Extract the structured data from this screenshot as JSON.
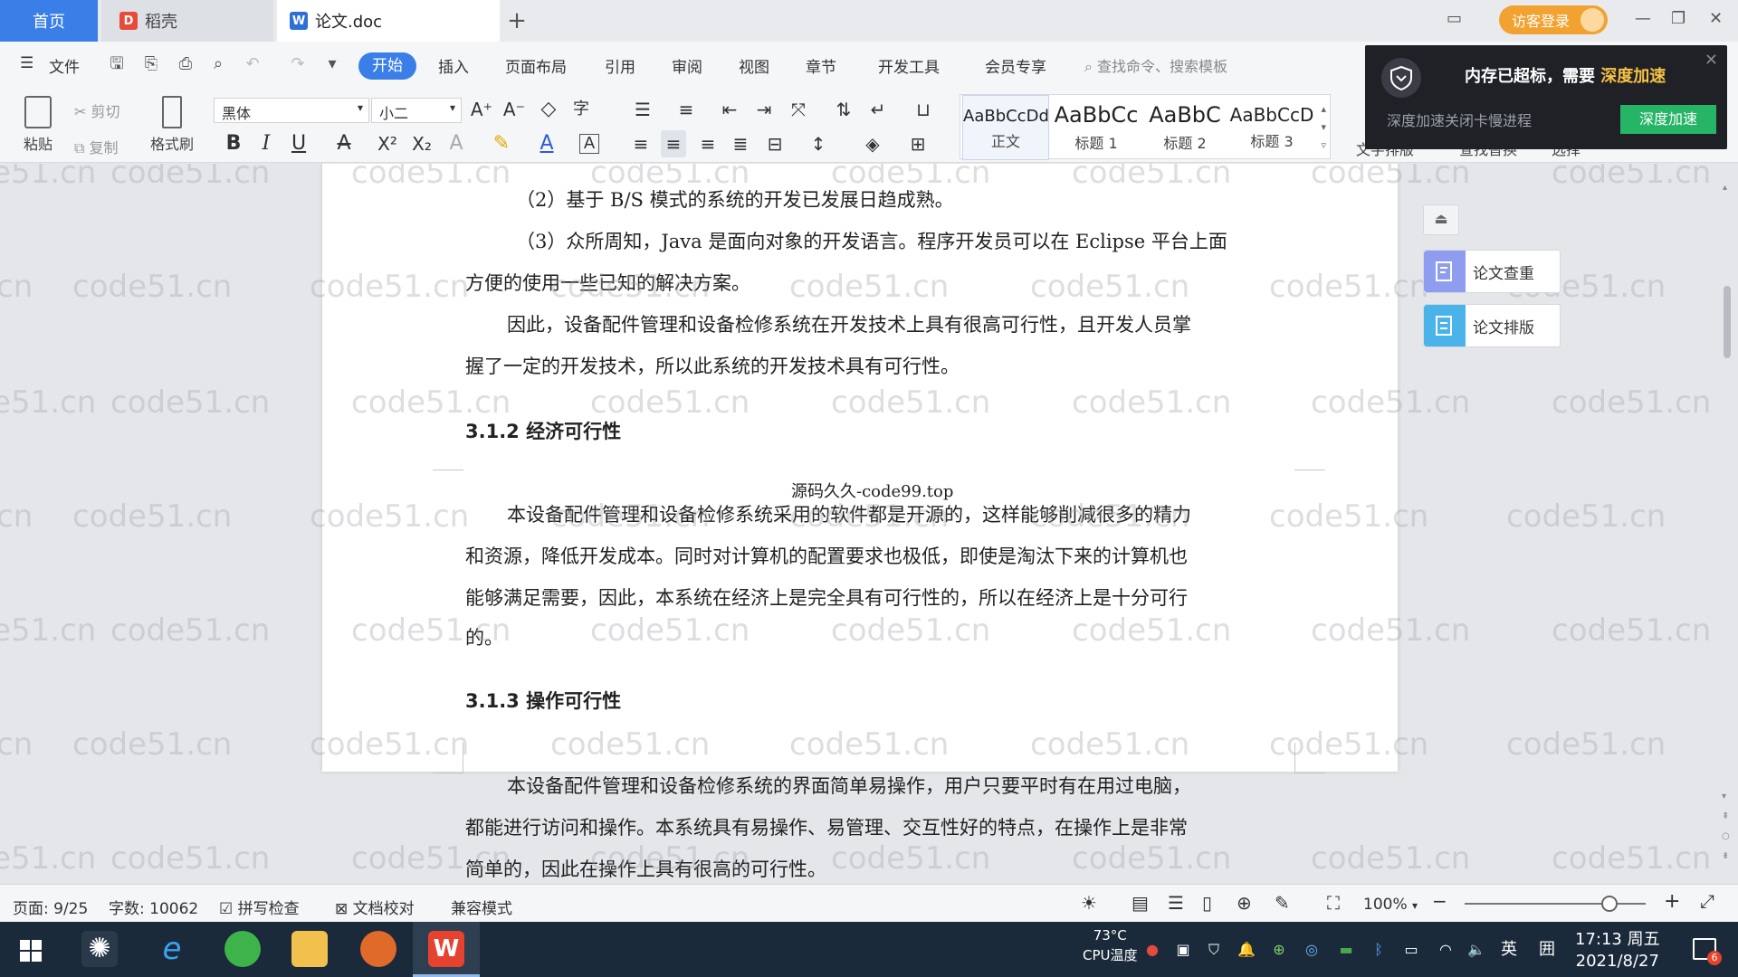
{
  "tabs": {
    "home": "首页",
    "daoke": "稻壳",
    "doc": "论文.doc",
    "new_tab": "+"
  },
  "visitor_login": "访客登录",
  "menu": {
    "file": "文件",
    "items": [
      "开始",
      "插入",
      "页面布局",
      "引用",
      "审阅",
      "视图",
      "章节",
      "开发工具",
      "会员专享"
    ],
    "search_placeholder": "查找命令、搜索模板"
  },
  "ribbon": {
    "paste": "粘贴",
    "cut": "剪切",
    "copy": "复制",
    "format_painter": "格式刷",
    "font": "黑体",
    "size": "小二",
    "styles": [
      {
        "preview": "AaBbCcDd",
        "name": "正文"
      },
      {
        "preview": "AaBbCc",
        "name": "标题 1"
      },
      {
        "preview": "AaBbC",
        "name": "标题 2"
      },
      {
        "preview": "AaBbCcD",
        "name": "标题 3"
      }
    ],
    "extra": [
      "文字排版",
      "查找替换",
      "选择"
    ]
  },
  "notice": {
    "title": "内存已超标，需要",
    "highlight": "深度加速",
    "subtitle": "深度加速关闭卡慢进程",
    "button": "深度加速"
  },
  "document": {
    "lines": [
      "（2）基于 B/S 模式的系统的开发已发展日趋成熟。",
      "（3）众所周知，Java 是面向对象的开发语言。程序开发员可以在 Eclipse 平台上面",
      "方便的使用一些已知的解决方案。",
      "因此，设备配件管理和设备检修系统在开发技术上具有很高可行性，且开发人员掌",
      "握了一定的开发技术，所以此系统的开发技术具有可行性。"
    ],
    "heading_312": "3.1.2 经济可行性",
    "header_text": "源码久久-code99.top",
    "econ_lines": [
      "本设备配件管理和设备检修系统采用的软件都是开源的，这样能够削减很多的精力",
      "和资源，降低开发成本。同时对计算机的配置要求也极低，即使是淘汰下来的计算机也",
      "能够满足需要，因此，本系统在经济上是完全具有可行性的，所以在经济上是十分可行",
      "的。"
    ],
    "heading_313": "3.1.3 操作可行性",
    "op_lines": [
      "本设备配件管理和设备检修系统的界面简单易操作，用户只要平时有在用过电脑，",
      "都能进行访问和操作。本系统具有易操作、易管理、交互性好的特点，在操作上是非常",
      "简单的，因此在操作上具有很高的可行性。"
    ]
  },
  "side_panel": {
    "check": "论文查重",
    "layout": "论文排版"
  },
  "watermark": "code51.cn",
  "status": {
    "page": "页面: 9/25",
    "words": "字数: 10062",
    "spell": "拼写检查",
    "proof": "文档校对",
    "compat": "兼容模式",
    "zoom": "100%",
    "zoom_level": 0.8
  },
  "taskbar": {
    "cpu_temp": "73°C",
    "cpu_label": "CPU温度",
    "ime": "英",
    "time": "17:13 周五",
    "date": "2021/8/27",
    "notif_count": "6"
  }
}
